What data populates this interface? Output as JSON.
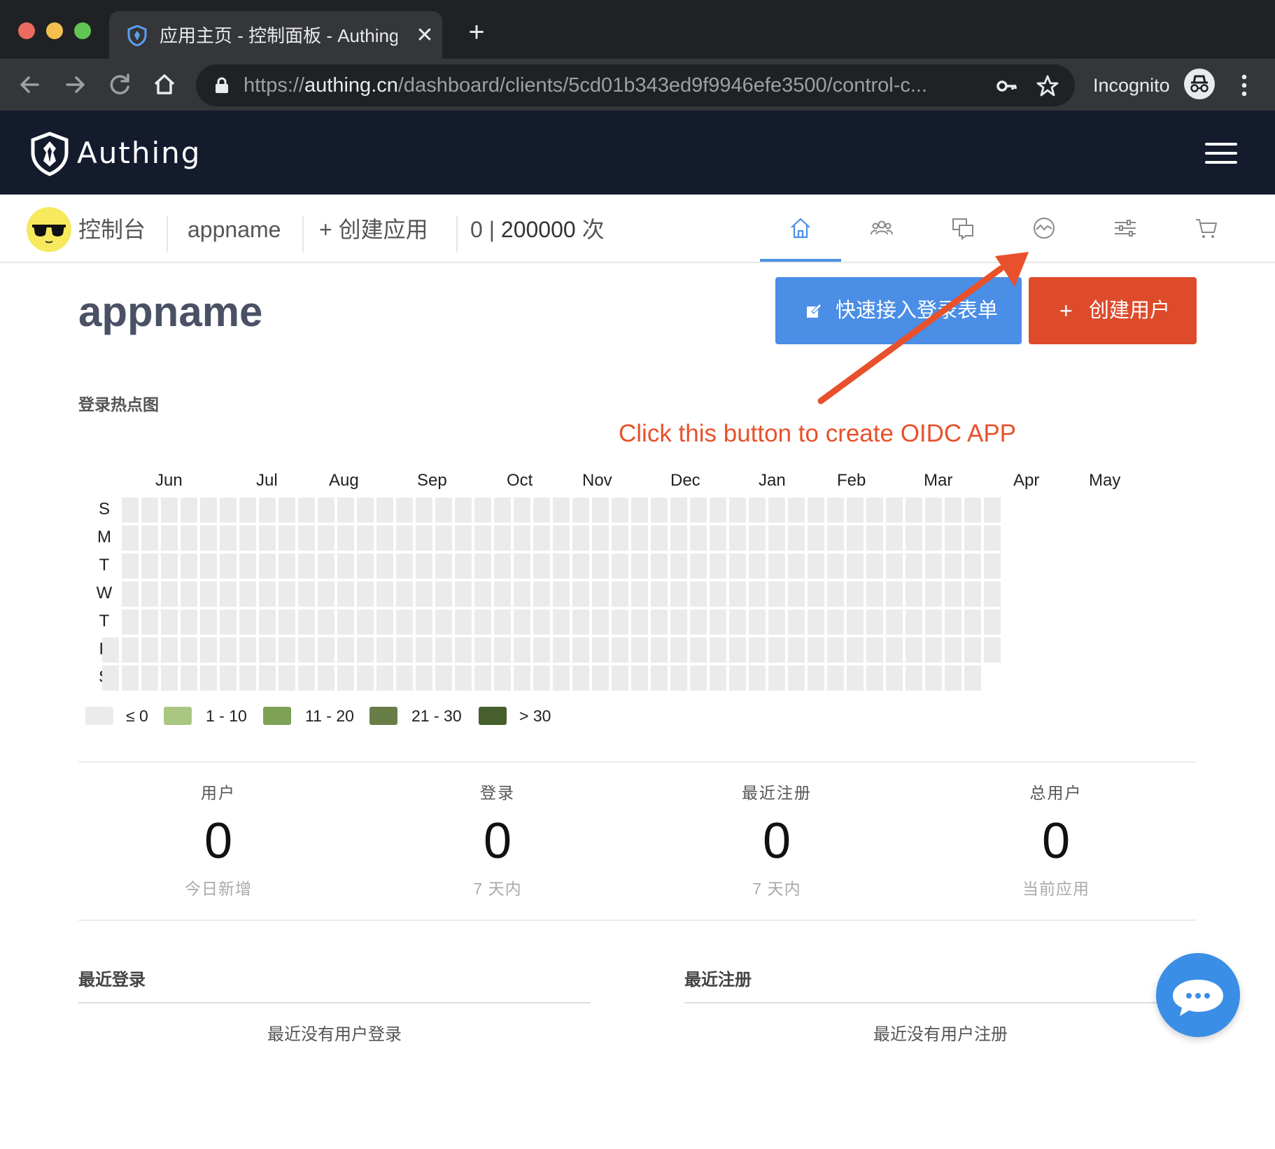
{
  "browser": {
    "tab_title": "应用主页 - 控制面板 - Authing 身",
    "tab_close": "✕",
    "new_tab": "+",
    "url_scheme": "https://",
    "url_host": "authing.cn",
    "url_path": "/dashboard/clients/5cd01b343ed9f9946efe3500/control-c...",
    "incognito_label": "Incognito"
  },
  "app": {
    "logo_text": "Authing"
  },
  "subnav": {
    "console": "控制台",
    "app_name": "appname",
    "create_app": "+ 创建应用",
    "usage_used": "0",
    "usage_sep": " | ",
    "usage_total": "200000",
    "usage_unit": " 次",
    "tabs": [
      "home",
      "users",
      "messages",
      "analytics",
      "settings",
      "cart"
    ],
    "active_tab": "home"
  },
  "main": {
    "title": "appname",
    "quick_login_button": "快速接入登录表单",
    "create_user_button": "创建用户",
    "create_user_plus": "+",
    "annotation": "Click this button to create OIDC APP"
  },
  "heatmap": {
    "title": "登录热点图",
    "months": [
      "Jun",
      "Jul",
      "Aug",
      "Sep",
      "Oct",
      "Nov",
      "Dec",
      "Jan",
      "Feb",
      "Mar",
      "Apr",
      "May"
    ],
    "days": [
      "S",
      "M",
      "T",
      "W",
      "T",
      "F",
      "S"
    ],
    "legend": [
      {
        "label": "≤ 0",
        "color": "#ebebeb"
      },
      {
        "label": "1 - 10",
        "color": "#a9c783"
      },
      {
        "label": "11 - 20",
        "color": "#7da155"
      },
      {
        "label": "21 - 30",
        "color": "#677f46"
      },
      {
        "label": "> 30",
        "color": "#465f2c"
      }
    ],
    "cell_color": "#ebebeb",
    "all_values": 0
  },
  "stats": [
    {
      "label": "用户",
      "value": "0",
      "sub": "今日新增"
    },
    {
      "label": "登录",
      "value": "0",
      "sub": "7 天内"
    },
    {
      "label": "最近注册",
      "value": "0",
      "sub": "7 天内"
    },
    {
      "label": "总用户",
      "value": "0",
      "sub": "当前应用"
    }
  ],
  "recent": {
    "login_title": "最近登录",
    "login_empty": "最近没有用户登录",
    "register_title": "最近注册",
    "register_empty": "最近没有用户注册"
  },
  "colors": {
    "primary_blue": "#4a8ee6",
    "danger_red": "#dd4b2b",
    "annotation_red": "#e8512b",
    "header_dark": "#141b2d"
  }
}
